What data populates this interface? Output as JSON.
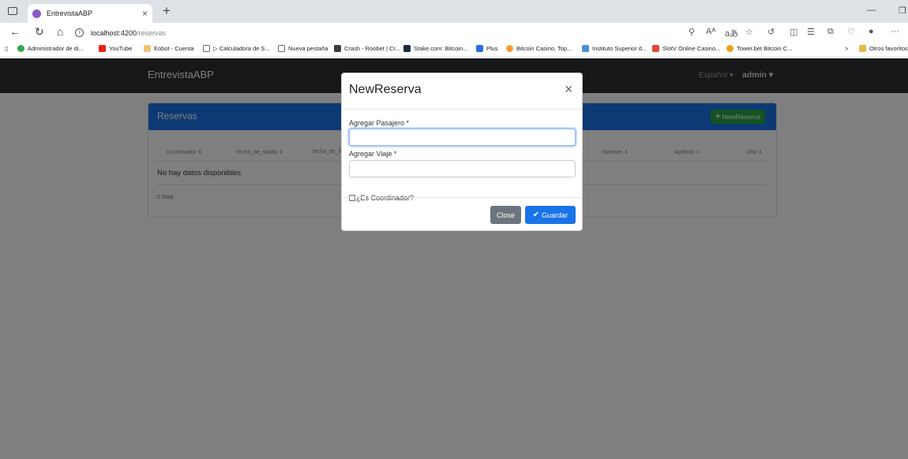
{
  "browser": {
    "tab_title": "EntrevistaABP",
    "tab_close": "×",
    "new_tab": "+",
    "url_host": "localhost:4200",
    "url_path": "/reservas",
    "bookmarks": [
      "Administrador de di...",
      "YouTube",
      "Eobot - Cuenta",
      "▷ Calculadora de S...",
      "Nueva pestaña",
      "Crash - Roobet | Cr...",
      "Stake.com: Bitcoin...",
      "Plus",
      "Bitcoin Casino, Top...",
      "Instituto Superior d...",
      "SlotV Online Casino...",
      "Tower.bet Bitcoin C..."
    ],
    "other_favorites": "Otros favoritos",
    "zoom_icon": "Aᴬ",
    "read_icon": "aあ"
  },
  "navbar": {
    "brand": "EntrevistaABP",
    "language": "Español ▾",
    "user": "admin ▾"
  },
  "card": {
    "title": "Reservas",
    "new_button": "NewReserva",
    "columns": [
      "Coordinador ⇕",
      "fecha_de_salida ⇕",
      "fecha_de_lle",
      "Nombre ⇕",
      "Apellido ⇕",
      "DNI ⇕"
    ],
    "empty_message": "No hay datos disponibles",
    "total": "0 Total"
  },
  "modal": {
    "title": "NewReserva",
    "close_x": "×",
    "label_pasajero": "Agregar Pasajero *",
    "pasajero_value": "",
    "label_viaje": "Agregar Viaje *",
    "viaje_value": "",
    "checkbox_label": "¿Es Coordinador?",
    "btn_close": "Close",
    "btn_save": "Guardar"
  },
  "colors": {
    "primary": "#1a73e8",
    "success": "#28a745",
    "secondary": "#6c757d",
    "navbar": "#2c2f33"
  }
}
